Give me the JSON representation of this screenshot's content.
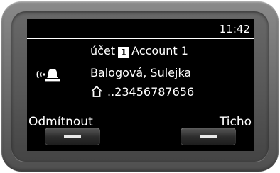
{
  "status_bar": {
    "time": "11:42"
  },
  "call": {
    "account_prefix": "účet",
    "account_number": "1",
    "account_name": "Account 1",
    "caller_name": "Balogová, Sulejka",
    "caller_number": "..23456787656",
    "call_icon": "ringing-bell-icon",
    "number_type_icon": "home-icon"
  },
  "softkeys": {
    "left_label": "Odmítnout",
    "right_label": "Ticho"
  },
  "colors": {
    "screen_bg": "#000000",
    "screen_text": "#ffffff",
    "device_body": "#6f6f6f"
  }
}
